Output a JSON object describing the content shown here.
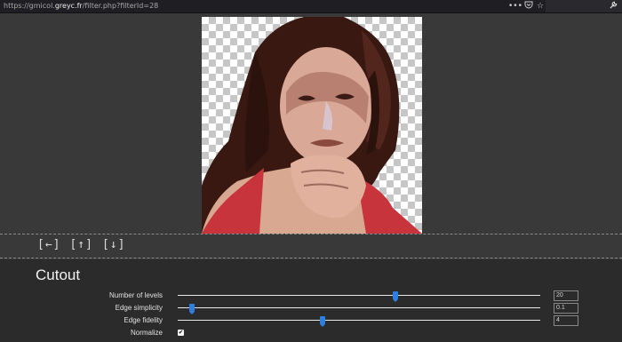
{
  "browser": {
    "url_prefix": "https://gmicol.",
    "url_host": "greyc.fr",
    "url_path": "/filter.php?filterId=28",
    "icons": [
      "more-icon",
      "pocket-icon",
      "bookmark-star-icon",
      "wrench-icon"
    ]
  },
  "nav": {
    "back": "[←]",
    "up": "[↑]",
    "down": "[↓]"
  },
  "filter": {
    "title": "Cutout",
    "params": [
      {
        "label": "Number of levels",
        "value": "20",
        "fraction": 0.6
      },
      {
        "label": "Edge simplicity",
        "value": "0.1",
        "fraction": 0.04
      },
      {
        "label": "Edge fidelity",
        "value": "4",
        "fraction": 0.4
      }
    ],
    "normalize": {
      "label": "Normalize",
      "checked": true,
      "mark": "✔"
    }
  },
  "colors": {
    "accent": "#2d7fe0",
    "panel": "#2b2b2b",
    "background": "#393939"
  }
}
